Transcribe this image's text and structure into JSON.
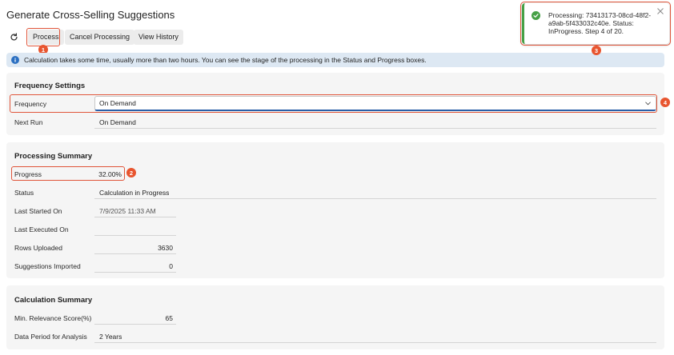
{
  "page": {
    "title": "Generate Cross-Selling Suggestions"
  },
  "toolbar": {
    "refresh_icon": "refresh-icon",
    "process_label": "Process",
    "cancel_label": "Cancel Processing",
    "history_label": "View History"
  },
  "info": {
    "icon": "info-icon",
    "text": "Calculation takes some time, usually more than two hours. You can see the stage of the processing in the Status and Progress boxes."
  },
  "frequency_settings": {
    "title": "Frequency Settings",
    "frequency_label": "Frequency",
    "frequency_value": "On Demand",
    "next_run_label": "Next Run",
    "next_run_value": "On Demand"
  },
  "processing_summary": {
    "title": "Processing Summary",
    "progress_label": "Progress",
    "progress_value": "32.00%",
    "status_label": "Status",
    "status_value": "Calculation in Progress",
    "last_started_label": "Last Started On",
    "last_started_value": "7/9/2025 11:33 AM",
    "last_executed_label": "Last Executed On",
    "last_executed_value": "",
    "rows_uploaded_label": "Rows Uploaded",
    "rows_uploaded_value": "3630",
    "suggestions_imported_label": "Suggestions Imported",
    "suggestions_imported_value": "0"
  },
  "calculation_summary": {
    "title": "Calculation Summary",
    "min_relevance_label": "Min. Relevance Score(%)",
    "min_relevance_value": "65",
    "data_period_label": "Data Period for Analysis",
    "data_period_value": "2 Years"
  },
  "toast": {
    "text": "Processing: 73413173-08cd-48f2-a9ab-5f433032c40e. Status: InProgress. Step 4 of 20.",
    "success_icon": "check-circle-icon",
    "close_icon": "close-icon"
  },
  "markers": [
    "1",
    "2",
    "3",
    "4"
  ],
  "colors": {
    "accent": "#2a5fa8",
    "highlight": "#e0553a",
    "success": "#46a046",
    "info": "#2b6fc1"
  }
}
